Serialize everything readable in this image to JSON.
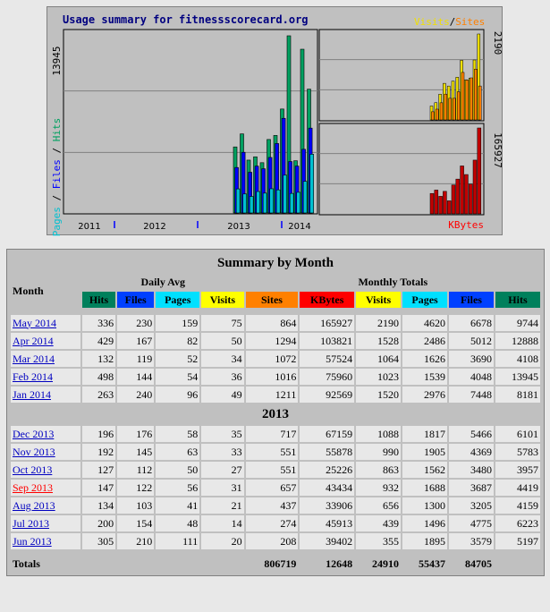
{
  "chart": {
    "title": "Usage summary for fitnessscorecard.org",
    "legend_right": [
      {
        "text": "Visits",
        "color": "#f0e000"
      },
      {
        "text": "/",
        "color": "#000000"
      },
      {
        "text": "Sites",
        "color": "#ff8000"
      }
    ],
    "left_axis_label_parts": [
      {
        "text": "Pages",
        "color": "#00c0d0"
      },
      {
        "text": " / ",
        "color": "#000000"
      },
      {
        "text": "Files",
        "color": "#0000ff"
      },
      {
        "text": " / ",
        "color": "#000000"
      },
      {
        "text": "Hits",
        "color": "#00a060"
      }
    ],
    "kbytes_label": "KBytes",
    "kbytes_color": "#ff0000"
  },
  "chart_data": [
    {
      "type": "bar",
      "name_ref": "hits-files-pages",
      "ymax_label": "13945",
      "ymax": 13945,
      "x_labels": [
        "2011",
        "2012",
        "2013",
        "2014"
      ],
      "categories": [
        "Jun 2013",
        "Jul 2013",
        "Aug 2013",
        "Sep 2013",
        "Oct 2013",
        "Nov 2013",
        "Dec 2013",
        "Jan 2014",
        "Feb 2014",
        "Mar 2014",
        "Apr 2014",
        "May 2014"
      ],
      "series": [
        {
          "name": "Hits",
          "color": "#00a060",
          "values": [
            5197,
            6223,
            4159,
            4419,
            3957,
            5783,
            6101,
            8181,
            13945,
            4108,
            12888,
            9744
          ]
        },
        {
          "name": "Files",
          "color": "#0000ff",
          "values": [
            3579,
            4775,
            3205,
            3687,
            3480,
            4369,
            5466,
            7448,
            4048,
            3690,
            5012,
            6678
          ]
        },
        {
          "name": "Pages",
          "color": "#00c0d0",
          "values": [
            1895,
            1496,
            1300,
            1688,
            1562,
            1905,
            1817,
            2976,
            1539,
            1626,
            2486,
            4620
          ]
        }
      ]
    },
    {
      "type": "bar",
      "name_ref": "visits-sites",
      "ymax_label": "2190",
      "ymax": 2190,
      "categories": [
        "Jun 2013",
        "Jul 2013",
        "Aug 2013",
        "Sep 2013",
        "Oct 2013",
        "Nov 2013",
        "Dec 2013",
        "Jan 2014",
        "Feb 2014",
        "Mar 2014",
        "Apr 2014",
        "May 2014"
      ],
      "series": [
        {
          "name": "Visits",
          "color": "#f0e000",
          "values": [
            355,
            439,
            656,
            932,
            863,
            990,
            1088,
            1520,
            1023,
            1064,
            1528,
            2190
          ]
        },
        {
          "name": "Sites",
          "color": "#ff8000",
          "values": [
            208,
            274,
            437,
            657,
            551,
            551,
            717,
            1211,
            1016,
            1072,
            1294,
            864
          ]
        }
      ]
    },
    {
      "type": "bar",
      "name_ref": "kbytes",
      "ymax_label": "165927",
      "ymax": 165927,
      "categories": [
        "Jun 2013",
        "Jul 2013",
        "Aug 2013",
        "Sep 2013",
        "Oct 2013",
        "Nov 2013",
        "Dec 2013",
        "Jan 2014",
        "Feb 2014",
        "Mar 2014",
        "Apr 2014",
        "May 2014"
      ],
      "series": [
        {
          "name": "KBytes",
          "color": "#c00000",
          "values": [
            39402,
            45913,
            33906,
            43434,
            25226,
            55878,
            67159,
            92569,
            75960,
            57524,
            103821,
            165927
          ]
        }
      ]
    }
  ],
  "table": {
    "title": "Summary by Month",
    "month_header": "Month",
    "daily_avg_header": "Daily Avg",
    "monthly_totals_header": "Monthly Totals",
    "daily_cols": [
      {
        "label": "Hits",
        "color": "#00805c"
      },
      {
        "label": "Files",
        "color": "#0040ff"
      },
      {
        "label": "Pages",
        "color": "#00e0ff"
      },
      {
        "label": "Visits",
        "color": "#ffff00"
      }
    ],
    "total_cols": [
      {
        "label": "Sites",
        "color": "#ff8000"
      },
      {
        "label": "KBytes",
        "color": "#ff0000"
      },
      {
        "label": "Visits",
        "color": "#ffff00"
      },
      {
        "label": "Pages",
        "color": "#00e0ff"
      },
      {
        "label": "Files",
        "color": "#0040ff"
      },
      {
        "label": "Hits",
        "color": "#00805c"
      }
    ],
    "groups": [
      {
        "year": "",
        "rows": [
          {
            "month": "May 2014",
            "current": false,
            "vals": [
              "336",
              "230",
              "159",
              "75",
              "864",
              "165927",
              "2190",
              "4620",
              "6678",
              "9744"
            ]
          },
          {
            "month": "Apr 2014",
            "current": false,
            "vals": [
              "429",
              "167",
              "82",
              "50",
              "1294",
              "103821",
              "1528",
              "2486",
              "5012",
              "12888"
            ]
          },
          {
            "month": "Mar 2014",
            "current": false,
            "vals": [
              "132",
              "119",
              "52",
              "34",
              "1072",
              "57524",
              "1064",
              "1626",
              "3690",
              "4108"
            ]
          },
          {
            "month": "Feb 2014",
            "current": false,
            "vals": [
              "498",
              "144",
              "54",
              "36",
              "1016",
              "75960",
              "1023",
              "1539",
              "4048",
              "13945"
            ]
          },
          {
            "month": "Jan 2014",
            "current": false,
            "vals": [
              "263",
              "240",
              "96",
              "49",
              "1211",
              "92569",
              "1520",
              "2976",
              "7448",
              "8181"
            ]
          }
        ]
      },
      {
        "year": "2013",
        "rows": [
          {
            "month": "Dec 2013",
            "current": false,
            "vals": [
              "196",
              "176",
              "58",
              "35",
              "717",
              "67159",
              "1088",
              "1817",
              "5466",
              "6101"
            ]
          },
          {
            "month": "Nov 2013",
            "current": false,
            "vals": [
              "192",
              "145",
              "63",
              "33",
              "551",
              "55878",
              "990",
              "1905",
              "4369",
              "5783"
            ]
          },
          {
            "month": "Oct 2013",
            "current": false,
            "vals": [
              "127",
              "112",
              "50",
              "27",
              "551",
              "25226",
              "863",
              "1562",
              "3480",
              "3957"
            ]
          },
          {
            "month": "Sep 2013",
            "current": true,
            "vals": [
              "147",
              "122",
              "56",
              "31",
              "657",
              "43434",
              "932",
              "1688",
              "3687",
              "4419"
            ]
          },
          {
            "month": "Aug 2013",
            "current": false,
            "vals": [
              "134",
              "103",
              "41",
              "21",
              "437",
              "33906",
              "656",
              "1300",
              "3205",
              "4159"
            ]
          },
          {
            "month": "Jul 2013",
            "current": false,
            "vals": [
              "200",
              "154",
              "48",
              "14",
              "274",
              "45913",
              "439",
              "1496",
              "4775",
              "6223"
            ]
          },
          {
            "month": "Jun 2013",
            "current": false,
            "vals": [
              "305",
              "210",
              "111",
              "20",
              "208",
              "39402",
              "355",
              "1895",
              "3579",
              "5197"
            ]
          }
        ]
      }
    ],
    "totals": {
      "label": "Totals",
      "vals": [
        "806719",
        "12648",
        "24910",
        "55437",
        "84705"
      ]
    }
  }
}
